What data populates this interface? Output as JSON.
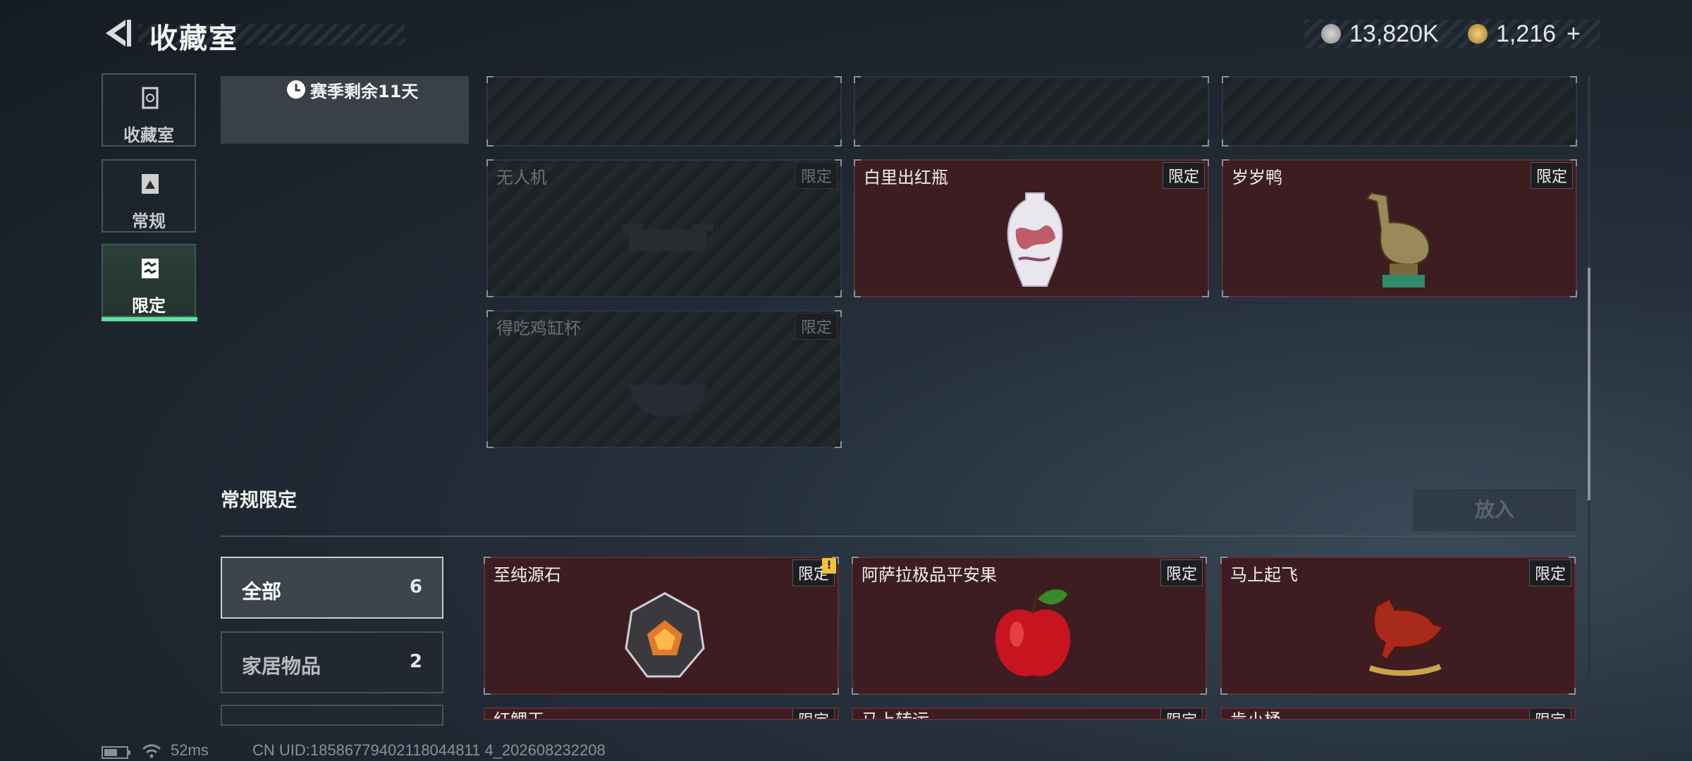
{
  "header": {
    "title": "收藏室",
    "currency": [
      {
        "icon": "silver-coin-icon",
        "value": "13,820K"
      },
      {
        "icon": "gold-coin-icon",
        "value": "1,216"
      }
    ],
    "add_symbol": "+"
  },
  "sidebar": {
    "items": [
      {
        "label": "收藏室",
        "icon": "collection-room-icon",
        "active": false
      },
      {
        "label": "常规",
        "icon": "regular-icon",
        "active": false
      },
      {
        "label": "限定",
        "icon": "limited-icon",
        "active": true
      }
    ]
  },
  "season": {
    "remaining": "赛季剩余11天"
  },
  "top_cards": [
    {
      "name": "无人机",
      "tag": "限定",
      "locked": true
    },
    {
      "name": "白里出红瓶",
      "tag": "限定",
      "locked": false
    },
    {
      "name": "岁岁鸭",
      "tag": "限定",
      "locked": false
    },
    {
      "name": "得吃鸡缸杯",
      "tag": "限定",
      "locked": true
    }
  ],
  "section": {
    "title": "常规限定",
    "put_button": "放入",
    "filters": [
      {
        "label": "全部",
        "count": "6",
        "active": true
      },
      {
        "label": "家居物品",
        "count": "2",
        "active": false
      }
    ],
    "cards": [
      {
        "name": "至纯源石",
        "tag": "限定",
        "badge": "!"
      },
      {
        "name": "阿萨拉极品平安果",
        "tag": "限定"
      },
      {
        "name": "马上起飞",
        "tag": "限定"
      },
      {
        "name": "红鲤王",
        "tag": "限定"
      },
      {
        "name": "马上转运",
        "tag": "限定"
      },
      {
        "name": "肯小桶",
        "tag": "限定"
      }
    ]
  },
  "footer": {
    "ping": "52ms",
    "uid": "CN UID:18586779402118044811 4_202608232208"
  },
  "colors": {
    "accent": "#5fe0a0",
    "card_bg": "#3d1d22"
  }
}
